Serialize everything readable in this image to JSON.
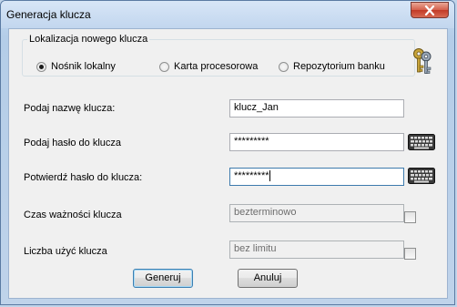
{
  "window": {
    "title": "Generacja klucza"
  },
  "location_group": {
    "legend": "Lokalizacja nowego klucza",
    "options": [
      {
        "label": "Nośnik lokalny",
        "checked": true
      },
      {
        "label": "Karta procesorowa",
        "checked": false
      },
      {
        "label": "Repozytorium banku",
        "checked": false
      }
    ]
  },
  "form": {
    "key_name": {
      "label": "Podaj nazwę klucza:",
      "value": "klucz_Jan"
    },
    "password": {
      "label": "Podaj hasło do klucza",
      "value": "*********"
    },
    "confirm_password": {
      "label": "Potwierdź hasło do klucza:",
      "value": "*********"
    },
    "validity": {
      "label": "Czas ważności klucza",
      "value": "bezterminowo",
      "enabled": false
    },
    "usage_count": {
      "label": "Liczba użyć klucza",
      "value": "bez limitu",
      "enabled": false
    }
  },
  "buttons": {
    "generate": "Generuj",
    "cancel": "Anuluj"
  },
  "icons": {
    "keys": "keys-icon",
    "keyboard": "keyboard-icon",
    "close": "close-icon"
  },
  "colors": {
    "close_button": "#c13a26",
    "focus_border": "#3d7bad"
  }
}
